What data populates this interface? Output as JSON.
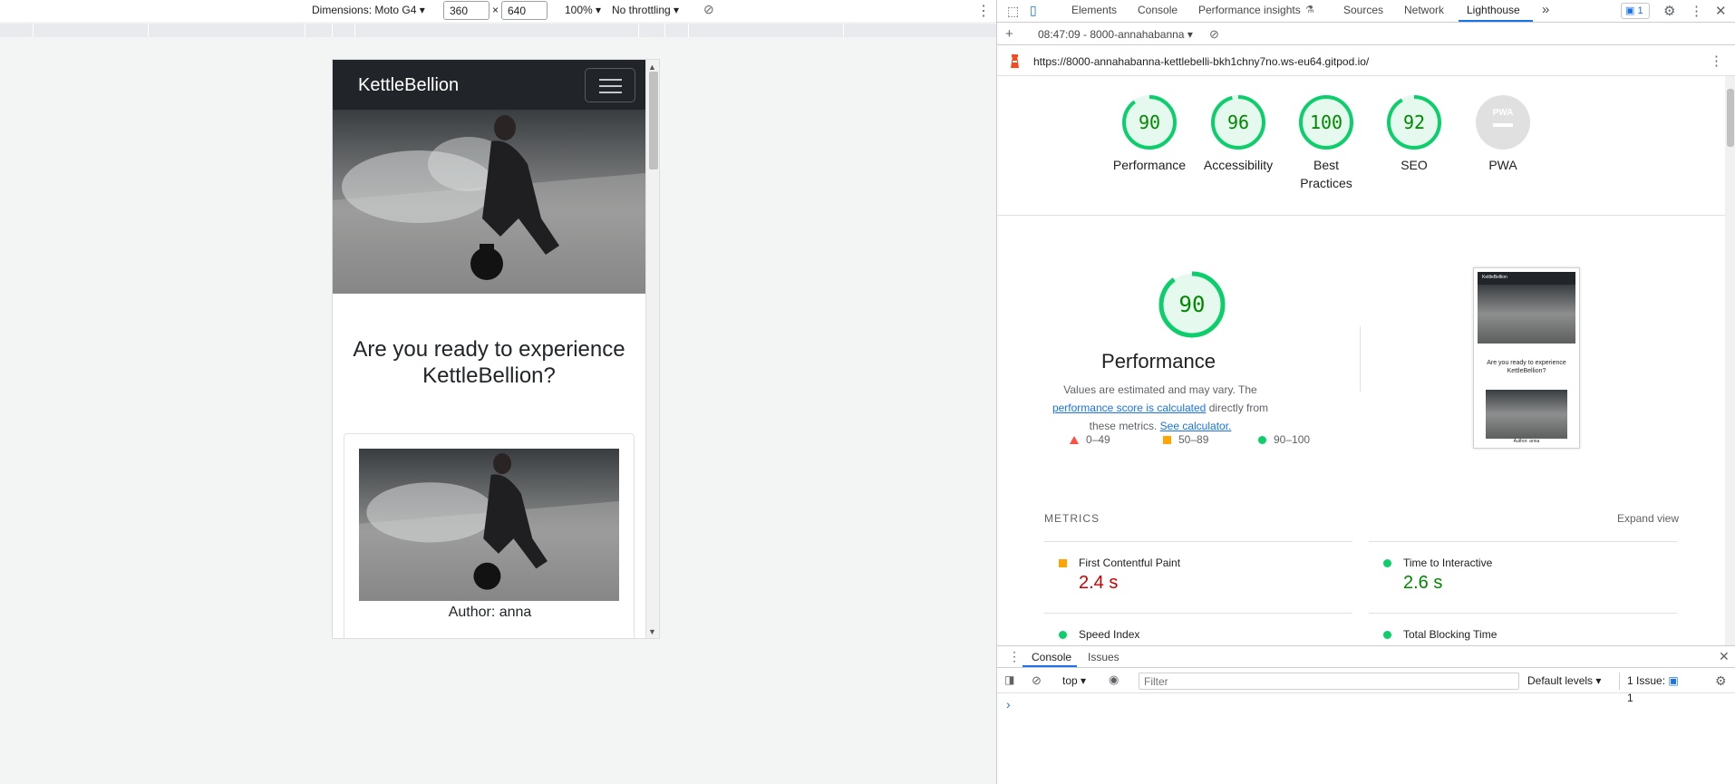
{
  "device_toolbar": {
    "dimensions_label": "Dimensions: Moto G4 ▾",
    "width": "360",
    "height": "640",
    "times": "×",
    "zoom": "100% ▾",
    "throttle": "No throttling ▾"
  },
  "site": {
    "brand": "KettleBellion",
    "heading": "Are you ready to experience KettleBellion?",
    "card_author": "Author: anna"
  },
  "devtools": {
    "tabs": [
      "Elements",
      "Console",
      "Performance insights",
      "Sources",
      "Network",
      "Lighthouse"
    ],
    "more": "»",
    "issues_count": "1",
    "report_selector": "08:47:09 - 8000-annahabanna ▾",
    "add": "+",
    "url": "https://8000-annahabanna-kettlebelli-bkh1chny7no.ws-eu64.gitpod.io/"
  },
  "lighthouse": {
    "scores": [
      {
        "label": "Performance",
        "value": "90",
        "score": 90
      },
      {
        "label": "Accessibility",
        "value": "96",
        "score": 96
      },
      {
        "label": "Best Practices",
        "value": "100",
        "score": 100
      },
      {
        "label": "SEO",
        "value": "92",
        "score": 92
      },
      {
        "label": "PWA",
        "value": "PWA",
        "score": null
      }
    ],
    "performance_title": "Performance",
    "performance_score": "90",
    "desc_prefix": "Values are estimated and may vary. The ",
    "desc_link1": "performance score is calculated",
    "desc_middle": " directly from these metrics. ",
    "desc_link2": "See calculator.",
    "legend": [
      "0–49",
      "50–89",
      "90–100"
    ],
    "thumb_heading": "Are you ready to experience KettleBellion?",
    "thumb_author": "Author: anna",
    "metrics_header": "METRICS",
    "expand_view": "Expand view",
    "metrics": [
      {
        "name": "First Contentful Paint",
        "value": "2.4 s",
        "status": "average"
      },
      {
        "name": "Time to Interactive",
        "value": "2.6 s",
        "status": "pass"
      },
      {
        "name": "Speed Index",
        "value": "",
        "status": "pass"
      },
      {
        "name": "Total Blocking Time",
        "value": "",
        "status": "pass"
      }
    ]
  },
  "console": {
    "tabs": [
      "Console",
      "Issues"
    ],
    "context": "top ▾",
    "filter_placeholder": "Filter",
    "levels": "Default levels ▾",
    "issues_label": "1 Issue:",
    "issues_count": "1",
    "prompt": "›"
  },
  "colors": {
    "pass": "#0cce6b",
    "pass_text": "#008800",
    "average": "#ffa400",
    "fail": "#ff4e42",
    "fail_text": "#cc0000",
    "accent": "#1a73e8"
  }
}
